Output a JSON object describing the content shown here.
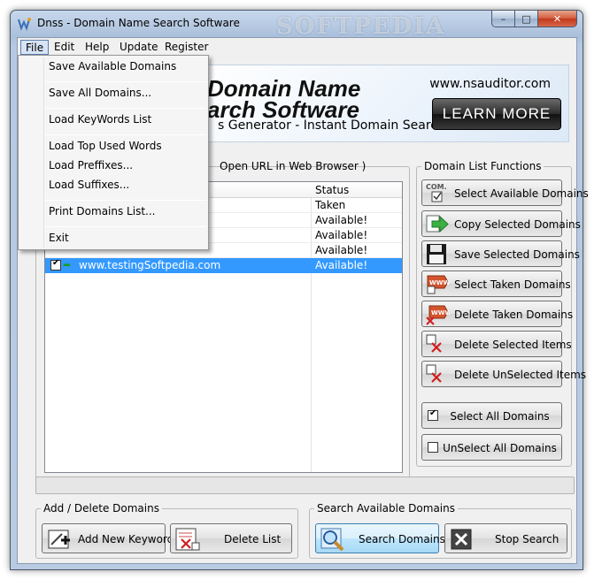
{
  "window": {
    "title": "Dnss - Domain Name Search Software",
    "watermark": "SOFTPEDIA",
    "min_glyph": "–",
    "max_glyph": "□",
    "close_glyph": "✕"
  },
  "menubar": {
    "items": [
      {
        "label": "File",
        "active": true
      },
      {
        "label": "Edit"
      },
      {
        "label": "Help"
      },
      {
        "label": "Update"
      },
      {
        "label": "Register"
      }
    ]
  },
  "file_menu": {
    "items": [
      "Save Available Domains",
      "Save All Domains...",
      "Load KeyWords List",
      "Load Top Used Words",
      "Load Preffixes...",
      "Load Suffixes...",
      "Print Domains List...",
      "Exit"
    ]
  },
  "banner": {
    "title_line1": "Domain Name",
    "title_line2": "arch Software",
    "subtitle": "s Generator - Instant Domain Search",
    "url": "www.nsauditor.com",
    "learn_more": "LEARN MORE"
  },
  "domain_list": {
    "open_url_label": "Open URL in Web Browser  )",
    "status_header": "Status",
    "rows": [
      {
        "domain": "",
        "status": "Taken",
        "selected": false
      },
      {
        "domain": "",
        "status": "Available!",
        "selected": false
      },
      {
        "domain": "",
        "status": "Available!",
        "selected": false
      },
      {
        "domain": "",
        "status": "Available!",
        "selected": false
      },
      {
        "domain": "www.testingSoftpedia.com",
        "status": "Available!",
        "selected": true
      }
    ]
  },
  "functions": {
    "title": "Domain List Functions",
    "buttons": [
      {
        "label": "Select Available Domains",
        "icon": "com-checkbox-icon"
      },
      {
        "label": "Copy Selected Domains",
        "icon": "green-arrow-icon"
      },
      {
        "label": "Save Selected Domains",
        "icon": "floppy-disk-icon"
      },
      {
        "label": "Select Taken Domains",
        "icon": "www-tag-icon"
      },
      {
        "label": "Delete Taken Domains",
        "icon": "www-delete-icon"
      },
      {
        "label": "Delete Selected Items",
        "icon": "checkbox-x-icon"
      },
      {
        "label": "Delete UnSelected Items",
        "icon": "checkbox-x-icon"
      }
    ],
    "select_all": "Select All Domains",
    "unselect_all": "UnSelect All Domains"
  },
  "add_delete": {
    "title": "Add / Delete Domains",
    "add_keywords": "Add New Keywords",
    "delete_list": "Delete List"
  },
  "search": {
    "title": "Search Available Domains",
    "search_button": "Search Domains",
    "stop_button": "Stop Search"
  }
}
